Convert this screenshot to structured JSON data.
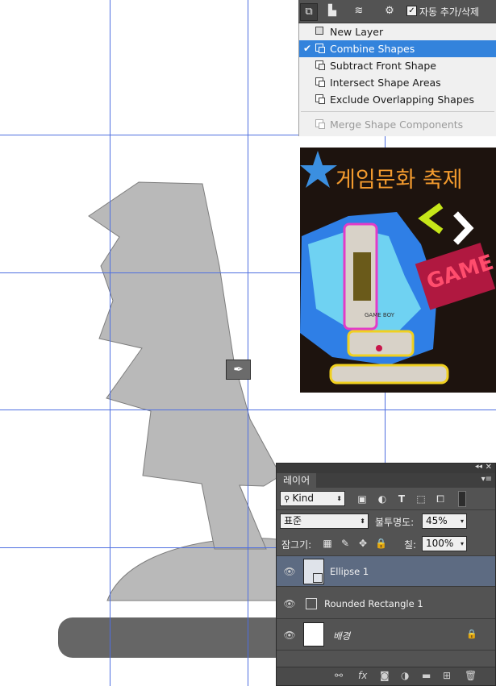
{
  "toolbar": {
    "icons": [
      "path-operations-icon",
      "path-alignment-icon",
      "path-arrangement-icon",
      "gear-icon"
    ],
    "auto_add_delete_checked": true,
    "auto_add_delete_label": "자동 추가/삭제"
  },
  "path_operations_menu": {
    "items": [
      {
        "label": "New Layer",
        "checked": false,
        "enabled": true
      },
      {
        "label": "Combine Shapes",
        "checked": true,
        "enabled": true
      },
      {
        "label": "Subtract Front Shape",
        "checked": false,
        "enabled": true
      },
      {
        "label": "Intersect Shape Areas",
        "checked": false,
        "enabled": true
      },
      {
        "label": "Exclude Overlapping Shapes",
        "checked": false,
        "enabled": true
      },
      {
        "label": "Merge Shape Components",
        "checked": false,
        "enabled": false
      }
    ]
  },
  "reference_poster": {
    "title_text": "게임문화 축제",
    "device_text": "GAME BOY",
    "badge_text": "GAME"
  },
  "layers_panel": {
    "tab_label": "레이어",
    "filter_kind": "Kind",
    "blend_mode": "표준",
    "opacity_label": "불투명도:",
    "opacity_value": "45%",
    "lock_label": "잠그기:",
    "fill_label": "칠:",
    "fill_value": "100%",
    "layers": [
      {
        "name": "Ellipse 1",
        "visible": true,
        "selected": true,
        "type": "shape",
        "locked": false
      },
      {
        "name": "Rounded Rectangle 1",
        "visible": true,
        "selected": false,
        "type": "shape",
        "locked": false
      },
      {
        "name": "배경",
        "visible": true,
        "selected": false,
        "type": "background",
        "locked": true
      }
    ],
    "footer_icons": [
      "link-icon",
      "fx-icon",
      "mask-icon",
      "adjustment-icon",
      "folder-icon",
      "new-layer-icon",
      "trash-icon"
    ]
  },
  "colors": {
    "guide": "#4f6fe0",
    "shape_fill": "#b9b9b9",
    "rounded_rect_fill": "#666666",
    "menu_highlight": "#3383dc",
    "panel_bg": "#535353",
    "selected_layer": "#5d6b82"
  }
}
